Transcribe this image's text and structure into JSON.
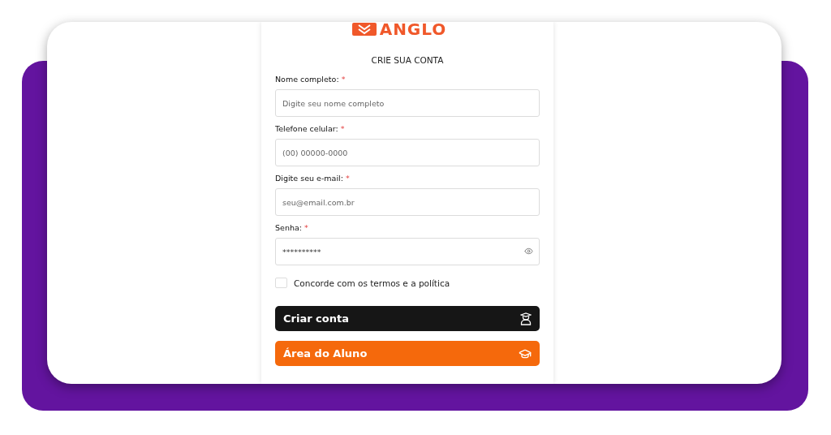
{
  "logo": {
    "text": "ANGLO"
  },
  "heading": "CRIE SUA CONTA",
  "fields": [
    {
      "label": "Nome completo:",
      "required_mark": "*",
      "placeholder": "Digite seu nome completo",
      "kind": "text"
    },
    {
      "label": "Telefone celular:",
      "required_mark": "*",
      "placeholder": "(00) 00000-0000",
      "kind": "text"
    },
    {
      "label": "Digite seu e-mail:",
      "required_mark": "*",
      "placeholder": "seu@email.com.br",
      "kind": "text"
    },
    {
      "label": "Senha:",
      "required_mark": "*",
      "value": "**********",
      "kind": "password"
    }
  ],
  "terms": {
    "label": "Concorde com os termos e a política",
    "checked": false
  },
  "buttons": [
    {
      "label": "Criar conta",
      "kind": "dark"
    },
    {
      "label": "Área do Aluno",
      "kind": "orange"
    }
  ]
}
